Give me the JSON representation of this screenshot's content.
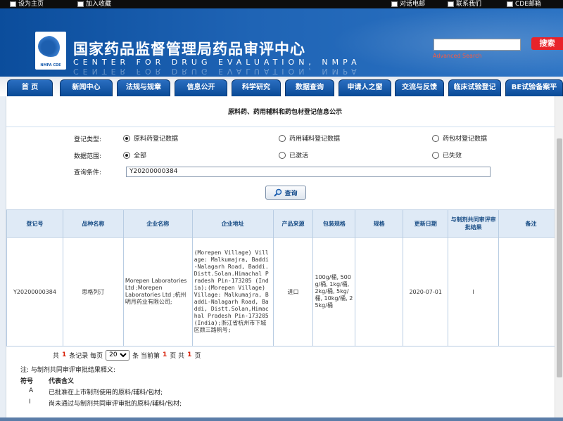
{
  "topbar": {
    "left": [
      "设为主页",
      "加入收藏"
    ],
    "right": [
      "对话电邮",
      "联系我们",
      "CDE邮箱"
    ]
  },
  "header": {
    "logo_text": "NMPA CDE",
    "title_cn": "国家药品监督管理局药品审评中心",
    "title_en": "CENTER FOR DRUG EVALUATION, NMPA",
    "search_button": "搜索",
    "advanced_search": "Advanced Search",
    "search_placeholder": ""
  },
  "nav": {
    "tabs": [
      "首 页",
      "新闻中心",
      "法规与规章",
      "信息公开",
      "科学研究",
      "数据查询",
      "申请人之窗",
      "交流与反馈",
      "临床试验登记",
      "BE试验备案平"
    ]
  },
  "page": {
    "heading": "原料药、药用辅料和药包材登记信息公示",
    "form": {
      "type_label": "登记类型:",
      "type_options": [
        "原料药登记数据",
        "药用辅料登记数据",
        "药包材登记数据"
      ],
      "type_selected": 0,
      "scope_label": "数据范围:",
      "scope_options": [
        "全部",
        "已激活",
        "已失效"
      ],
      "scope_selected": 0,
      "query_label": "查询条件:",
      "query_value": "Y20200000384",
      "query_button": "查询"
    },
    "table": {
      "headers": [
        "登记号",
        "品种名称",
        "企业名称",
        "企业地址",
        "产品来源",
        "包装规格",
        "规格",
        "更新日期",
        "与制剂共同审评审批结果",
        "备注"
      ],
      "rows": [
        {
          "reg_no": "Y20200000384",
          "name": "思格列汀",
          "company": "Morepen Laboratories Ltd ;Morepen Laboratories Ltd ;杭州明月药业有限公司;",
          "address": "(Morepen Village) Village: Malkumajra, Baddi-Nalagarh Road, Baddi. Distt.Solan.Himachal Pradesh Pin-173205 (India);(Morepen Village) Village: Malkumajra, Baddi-Nalagarh Road, Baddi, Distt.Solan,Himachal Pradesh Pin-173205 (India);浙江省杭州市下城区颜三路帆号;",
          "source": "进口",
          "packaging": "100g/桶, 500g/桶, 1kg/桶, 2kg/桶, 5kg/桶, 10kg/桶, 25kg/桶",
          "spec": "",
          "date": "2020-07-01",
          "result": "I",
          "remark": ""
        }
      ]
    },
    "pager": {
      "prefix": "共",
      "total": "1",
      "mid": "条记录 每页",
      "page_size": "20",
      "suffix1": "条 当前第",
      "current": "1",
      "suffix2": "页 共",
      "pages": "1",
      "suffix3": "页"
    },
    "note": "注: 与制剂共同审评审批结果释义:",
    "legend": {
      "header": [
        "符号",
        "代表含义"
      ],
      "rows": [
        [
          "A",
          "已批准在上市制剂使用的原料/辅料/包材;"
        ],
        [
          "I",
          "尚未通过与制剂共同审评审批的原料/辅料/包材;"
        ]
      ]
    }
  },
  "colors": {
    "header_blue": "#0b4d9c",
    "tab_blue": "#2a6ec0",
    "search_red": "#e8232a",
    "table_header_bg": "#dfeaf6"
  }
}
